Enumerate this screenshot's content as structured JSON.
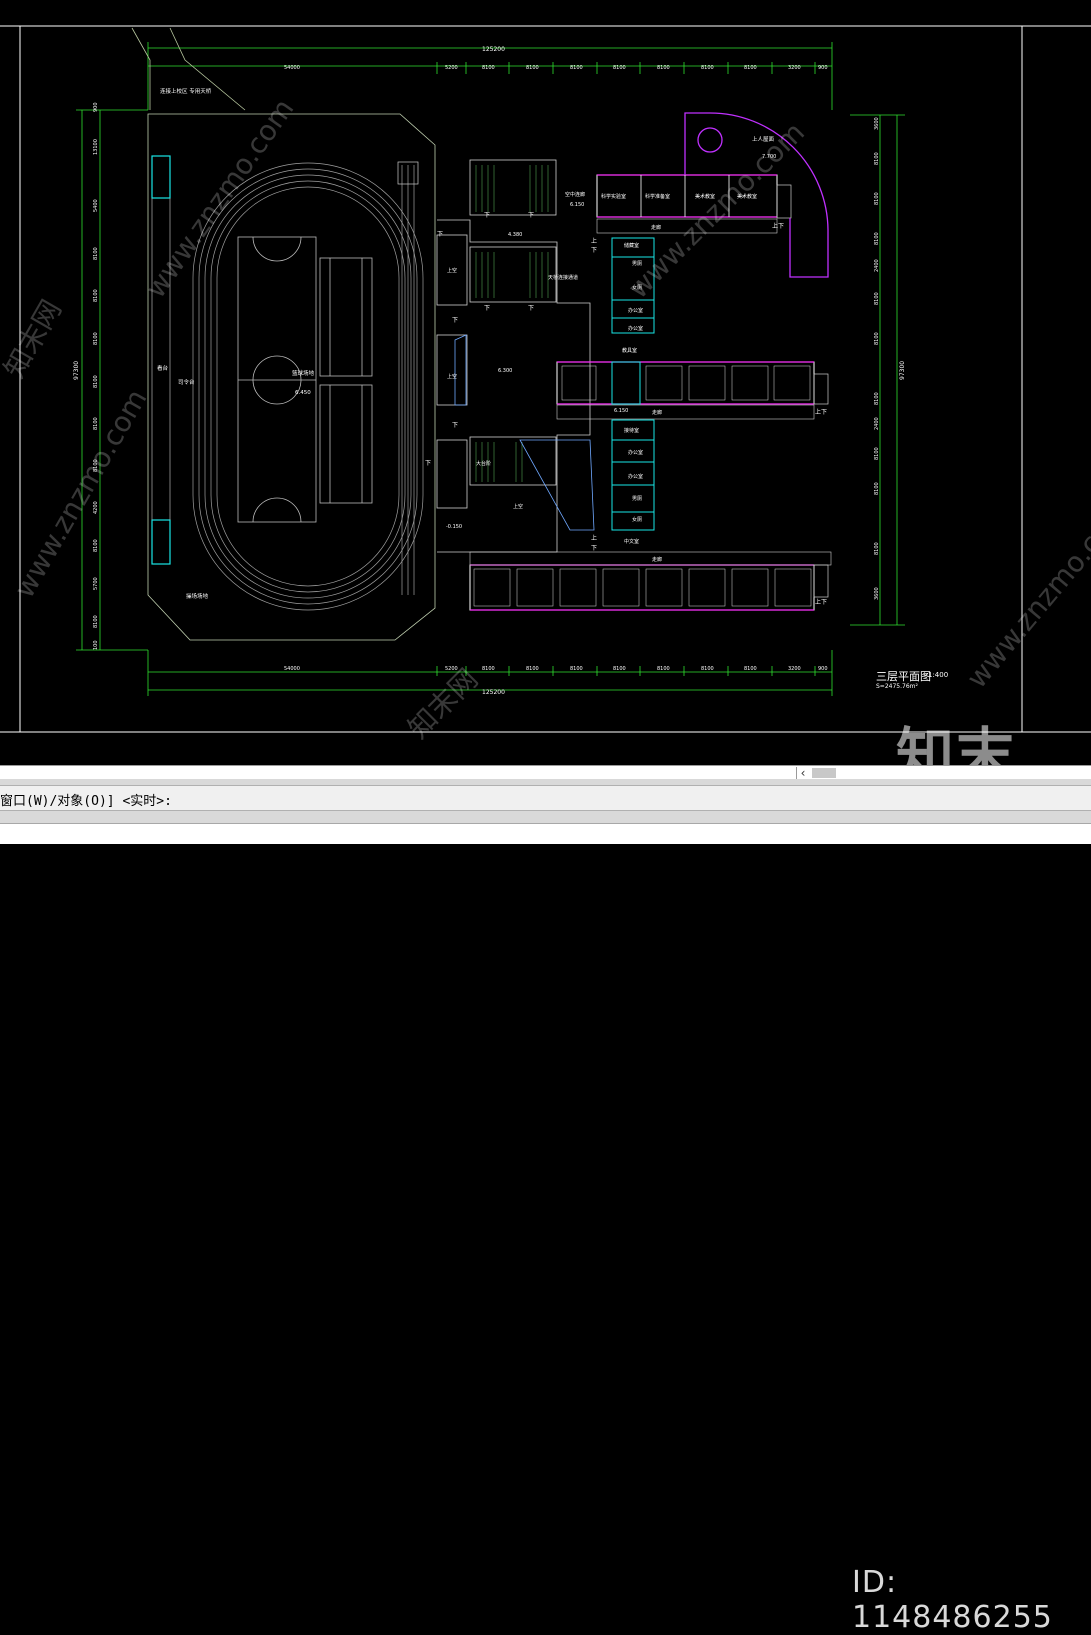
{
  "drawing": {
    "title": "三层平面图",
    "scale": "1:400",
    "area": "S=2475.76m²",
    "dims_top_total": "125200",
    "dims_top": [
      "54000",
      "5200",
      "8100",
      "8100",
      "8100",
      "8100",
      "8100",
      "8100",
      "8100",
      "3200",
      "900"
    ],
    "dims_bottom_total": "125200",
    "dims_bottom": [
      "54000",
      "5200",
      "8100",
      "8100",
      "8100",
      "8100",
      "8100",
      "8100",
      "8100",
      "3200",
      "900"
    ],
    "dims_left_total": "97300",
    "dims_left": [
      "900",
      "13100",
      "5400",
      "8100",
      "8100",
      "8100",
      "8100",
      "8100",
      "8100",
      "4200",
      "8100",
      "5700",
      "8100",
      "100"
    ],
    "dims_right_total": "97300",
    "dims_right": [
      "3600",
      "8100",
      "8100",
      "8100",
      "2400",
      "8100",
      "8100",
      "8100",
      "2400",
      "8100",
      "8100",
      "8100",
      "3600"
    ],
    "labels": {
      "road_note": "连接上校区\n专用天桥",
      "playground": "操场场地",
      "stand": "司令台",
      "seats": "看台",
      "basketball": "篮球场地",
      "elev_playground": "6.450",
      "roof": "上人屋面",
      "roof_elev": "7.700",
      "elev_1": "4.380",
      "elev_2": "6.150",
      "elev_3": "4.380",
      "elev_4": "6.300",
      "elev_5": "6.150",
      "elev_6": "-0.150",
      "hall": "大台阶",
      "open": "上空",
      "open2": "上空",
      "open3": "上空",
      "open4": "上空",
      "covered": "空中连廊",
      "bridge": "天桥连接通道",
      "rooms_top": [
        "科学实验室",
        "科学准备室",
        "美术教室",
        "美术教室"
      ],
      "offices": [
        "储藏室",
        "男厕",
        "女厕",
        "办公室",
        "办公室",
        "教具室"
      ],
      "offices2": [
        "接待室",
        "办公室",
        "办公室",
        "男厕",
        "女厕",
        "中文室"
      ],
      "corridor": "走廊",
      "down": "下",
      "up": "上",
      "updown": "上下"
    }
  },
  "hscroll": {
    "arrow": "‹"
  },
  "command": {
    "history": "窗口(W)/对象(O)] <实时>:"
  },
  "watermark": {
    "logo": "知末",
    "id": "ID: 1148486255",
    "site": "www.znzmo.com",
    "site_cn": "知末网"
  }
}
